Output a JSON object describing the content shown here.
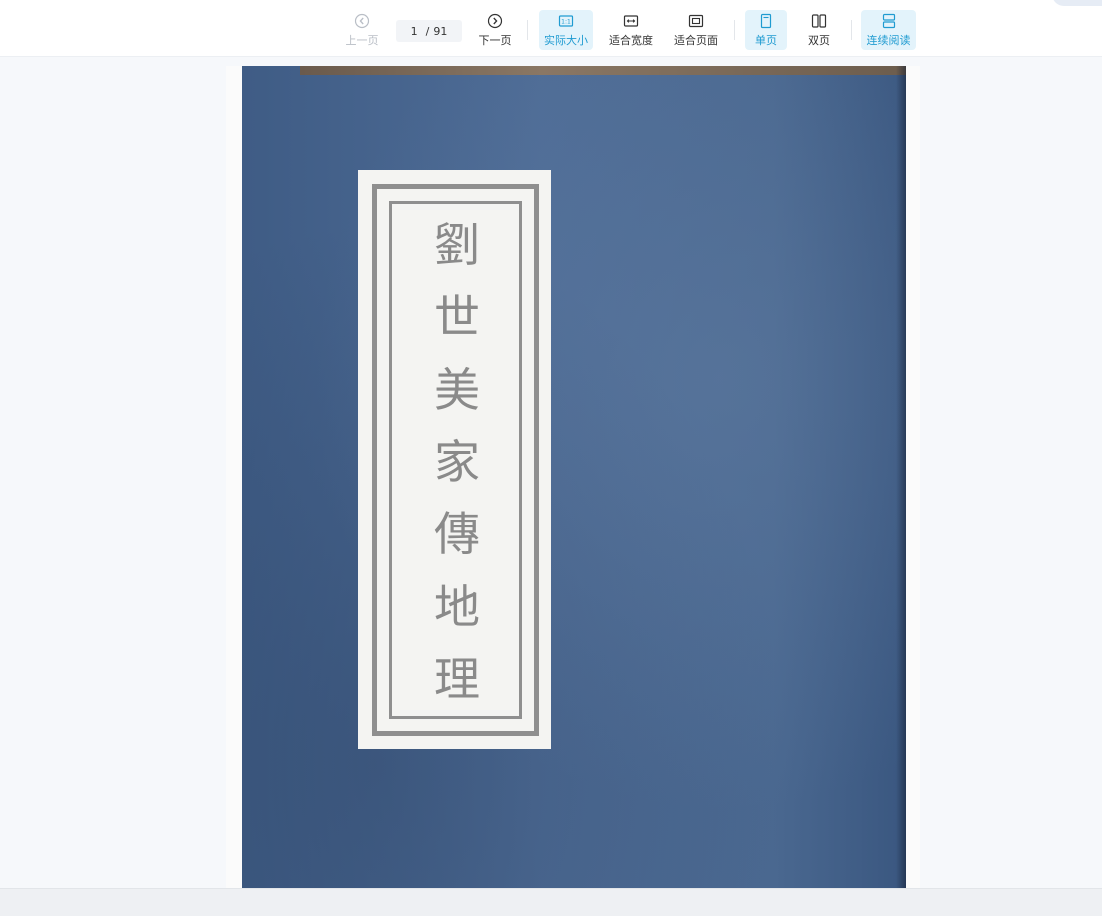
{
  "toolbar": {
    "prev_label": "上一页",
    "current_page": "1",
    "page_separator": "/",
    "total_pages": "91",
    "next_label": "下一页",
    "actual_size_label": "实际大小",
    "fit_width_label": "适合宽度",
    "fit_page_label": "适合页面",
    "single_page_label": "单页",
    "double_page_label": "双页",
    "continuous_label": "连续阅读"
  },
  "icons": {
    "prev": "chevron-left-circle-icon",
    "next": "chevron-right-circle-icon",
    "actual_size": "one-to-one-icon",
    "fit_width": "fit-width-icon",
    "fit_page": "fit-page-icon",
    "single_page": "single-page-icon",
    "double_page": "double-page-icon",
    "continuous": "continuous-scroll-icon"
  },
  "document": {
    "title_chars": [
      "劉",
      "世",
      "美",
      "家",
      "傳",
      "地",
      "理"
    ]
  },
  "colors": {
    "accent": "#1f9bd1",
    "accent_bg": "#e3f3fb",
    "cover_blue": "#4c6a93",
    "label_paper": "#f4f4f2",
    "label_ink": "#8a8a8a"
  }
}
